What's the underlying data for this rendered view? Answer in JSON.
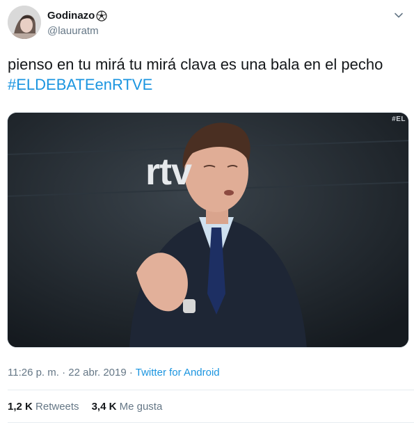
{
  "user": {
    "display_name": "Godinazo",
    "handle": "@lauuratm"
  },
  "tweet": {
    "text": "pienso en tu mirá tu mirá clava es una bala en el pecho",
    "hashtag": "#ELDEBATEenRTVE",
    "media": {
      "watermark": "#EL",
      "logo": "rtv"
    },
    "time": "11:26 p. m.",
    "date": "22 abr. 2019",
    "separator": " · ",
    "client": "Twitter for Android"
  },
  "stats": {
    "retweets_count": "1,2 K",
    "retweets_label": "Retweets",
    "likes_count": "3,4 K",
    "likes_label": "Me gusta"
  },
  "icons": {
    "ball": "soccer-ball-icon",
    "chevron": "chevron-down-icon"
  },
  "colors": {
    "link": "#1b95e0",
    "secondary": "#657786",
    "text": "#14171a"
  }
}
